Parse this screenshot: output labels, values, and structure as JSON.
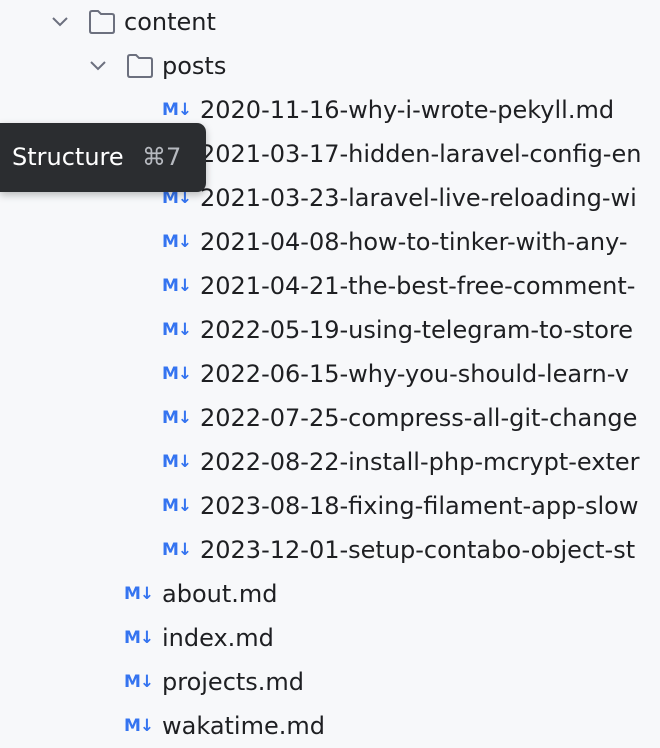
{
  "tree": {
    "content_folder": {
      "name": "content",
      "expanded": true
    },
    "posts_folder": {
      "name": "posts",
      "expanded": true
    },
    "md_icon_text": "M↓",
    "posts": [
      "2020-11-16-why-i-wrote-pekyll.md",
      "2021-03-17-hidden-laravel-config-en",
      "2021-03-23-laravel-live-reloading-wi",
      "2021-04-08-how-to-tinker-with-any-",
      "2021-04-21-the-best-free-comment-",
      "2022-05-19-using-telegram-to-store",
      "2022-06-15-why-you-should-learn-v",
      "2022-07-25-compress-all-git-change",
      "2022-08-22-install-php-mcrypt-exter",
      "2023-08-18-fixing-filament-app-slow",
      "2023-12-01-setup-contabo-object-st"
    ],
    "content_files": [
      "about.md",
      "index.md",
      "projects.md",
      "wakatime.md"
    ]
  },
  "tooltip": {
    "label": "Structure",
    "shortcut": "⌘7"
  },
  "colors": {
    "background": "#f7f8fa",
    "markdown_icon": "#3574f0",
    "tooltip_bg": "#2b2d30",
    "text": "#1e1f22"
  }
}
